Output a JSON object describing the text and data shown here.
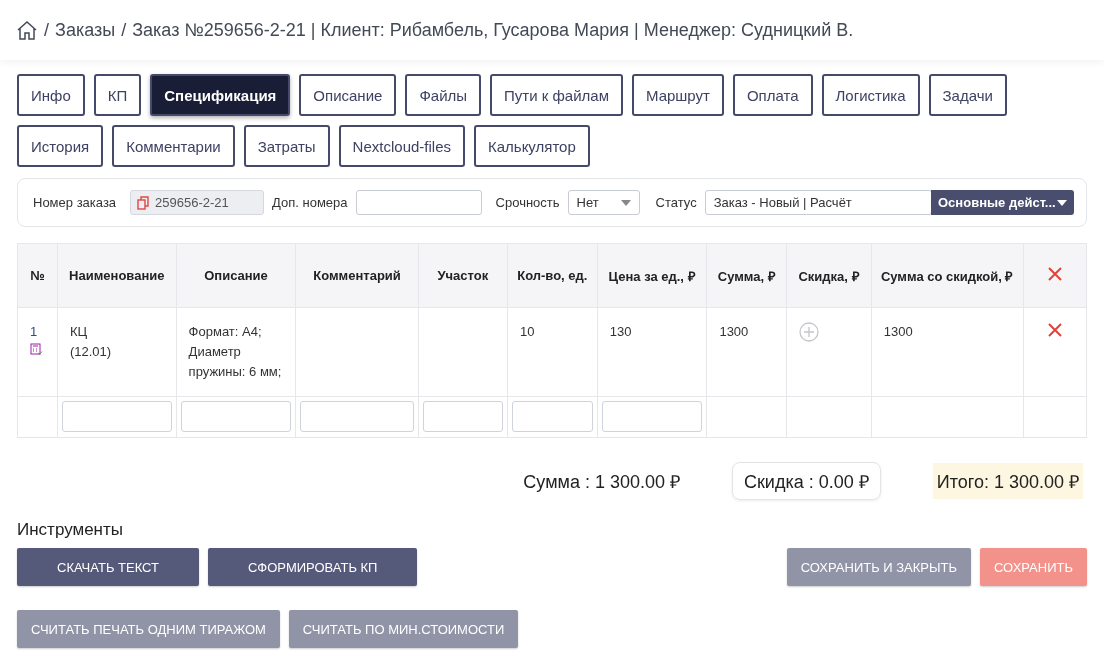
{
  "breadcrumb": {
    "items": [
      {
        "separator": "/",
        "label": "Заказы"
      },
      {
        "separator": "/",
        "label": "Заказ №259656-2-21 | Клиент: Рибамбель, Гусарова Мария | Менеджер: Судницкий В."
      }
    ]
  },
  "tabs": [
    [
      {
        "label": "Инфо",
        "selected": false
      },
      {
        "label": "КП",
        "selected": false
      },
      {
        "label": "Спецификация",
        "selected": true
      },
      {
        "label": "Описание",
        "selected": false
      },
      {
        "label": "Файлы",
        "selected": false
      },
      {
        "label": "Пути к файлам",
        "selected": false
      },
      {
        "label": "Маршрут",
        "selected": false
      },
      {
        "label": "Оплата",
        "selected": false
      },
      {
        "label": "Логистика",
        "selected": false
      },
      {
        "label": "Задачи",
        "selected": false
      }
    ],
    [
      {
        "label": "История",
        "selected": false
      },
      {
        "label": "Комментарии",
        "selected": false
      },
      {
        "label": "Затраты",
        "selected": false
      },
      {
        "label": "Nextcloud-files",
        "selected": false
      },
      {
        "label": "Калькулятор",
        "selected": false
      }
    ]
  ],
  "order_panel": {
    "order_number_label": "Номер заказа",
    "order_number": "259656-2-21",
    "extra_numbers_label": "Доп. номера",
    "urgency_label": "Срочность",
    "urgency": "Нет",
    "status_label": "Статус",
    "status": "Заказ - Новый | Расчёт",
    "actions": "Основные дейст..."
  },
  "table": {
    "columns": [
      "№",
      "Наименование",
      "Описание",
      "Комментарий",
      "Участок",
      "Кол-во, ед.",
      "Цена за ед., ₽",
      "Сумма, ₽",
      "Скидка, ₽",
      "Сумма со скидкой, ₽"
    ],
    "rows": [
      {
        "number": "1",
        "name": [
          "КЦ",
          "(12.01)"
        ],
        "description": "Формат: А4; Диаметр пружины: 6 мм;",
        "comment": "",
        "area": "",
        "quantity": "10",
        "price": "130",
        "sum": "1300",
        "sum_discounted": "1300"
      }
    ]
  },
  "totals": {
    "sum": "Сумма : 1 300.00 ₽",
    "discount": "Скидка : 0.00 ₽",
    "total": "Итого: 1 300.00 ₽"
  },
  "tools": {
    "title": "Инструменты",
    "rows": [
      [
        {
          "label": "СКАЧАТЬ ТЕКСТ",
          "kind": "primary"
        },
        {
          "label": "СФОРМИРОВАТЬ КП",
          "kind": "primary"
        },
        {
          "label": "СОХРАНИТЬ И ЗАКРЫТЬ",
          "kind": "muted"
        },
        {
          "label": "СОХРАНИТЬ",
          "kind": "danger"
        }
      ],
      [
        {
          "label": "СЧИТАТЬ ПЕЧАТЬ ОДНИМ ТИРАЖОМ",
          "kind": "muted"
        },
        {
          "label": "СЧИТАТЬ ПО МИН.СТОИМОСТИ",
          "kind": "muted"
        }
      ]
    ]
  }
}
